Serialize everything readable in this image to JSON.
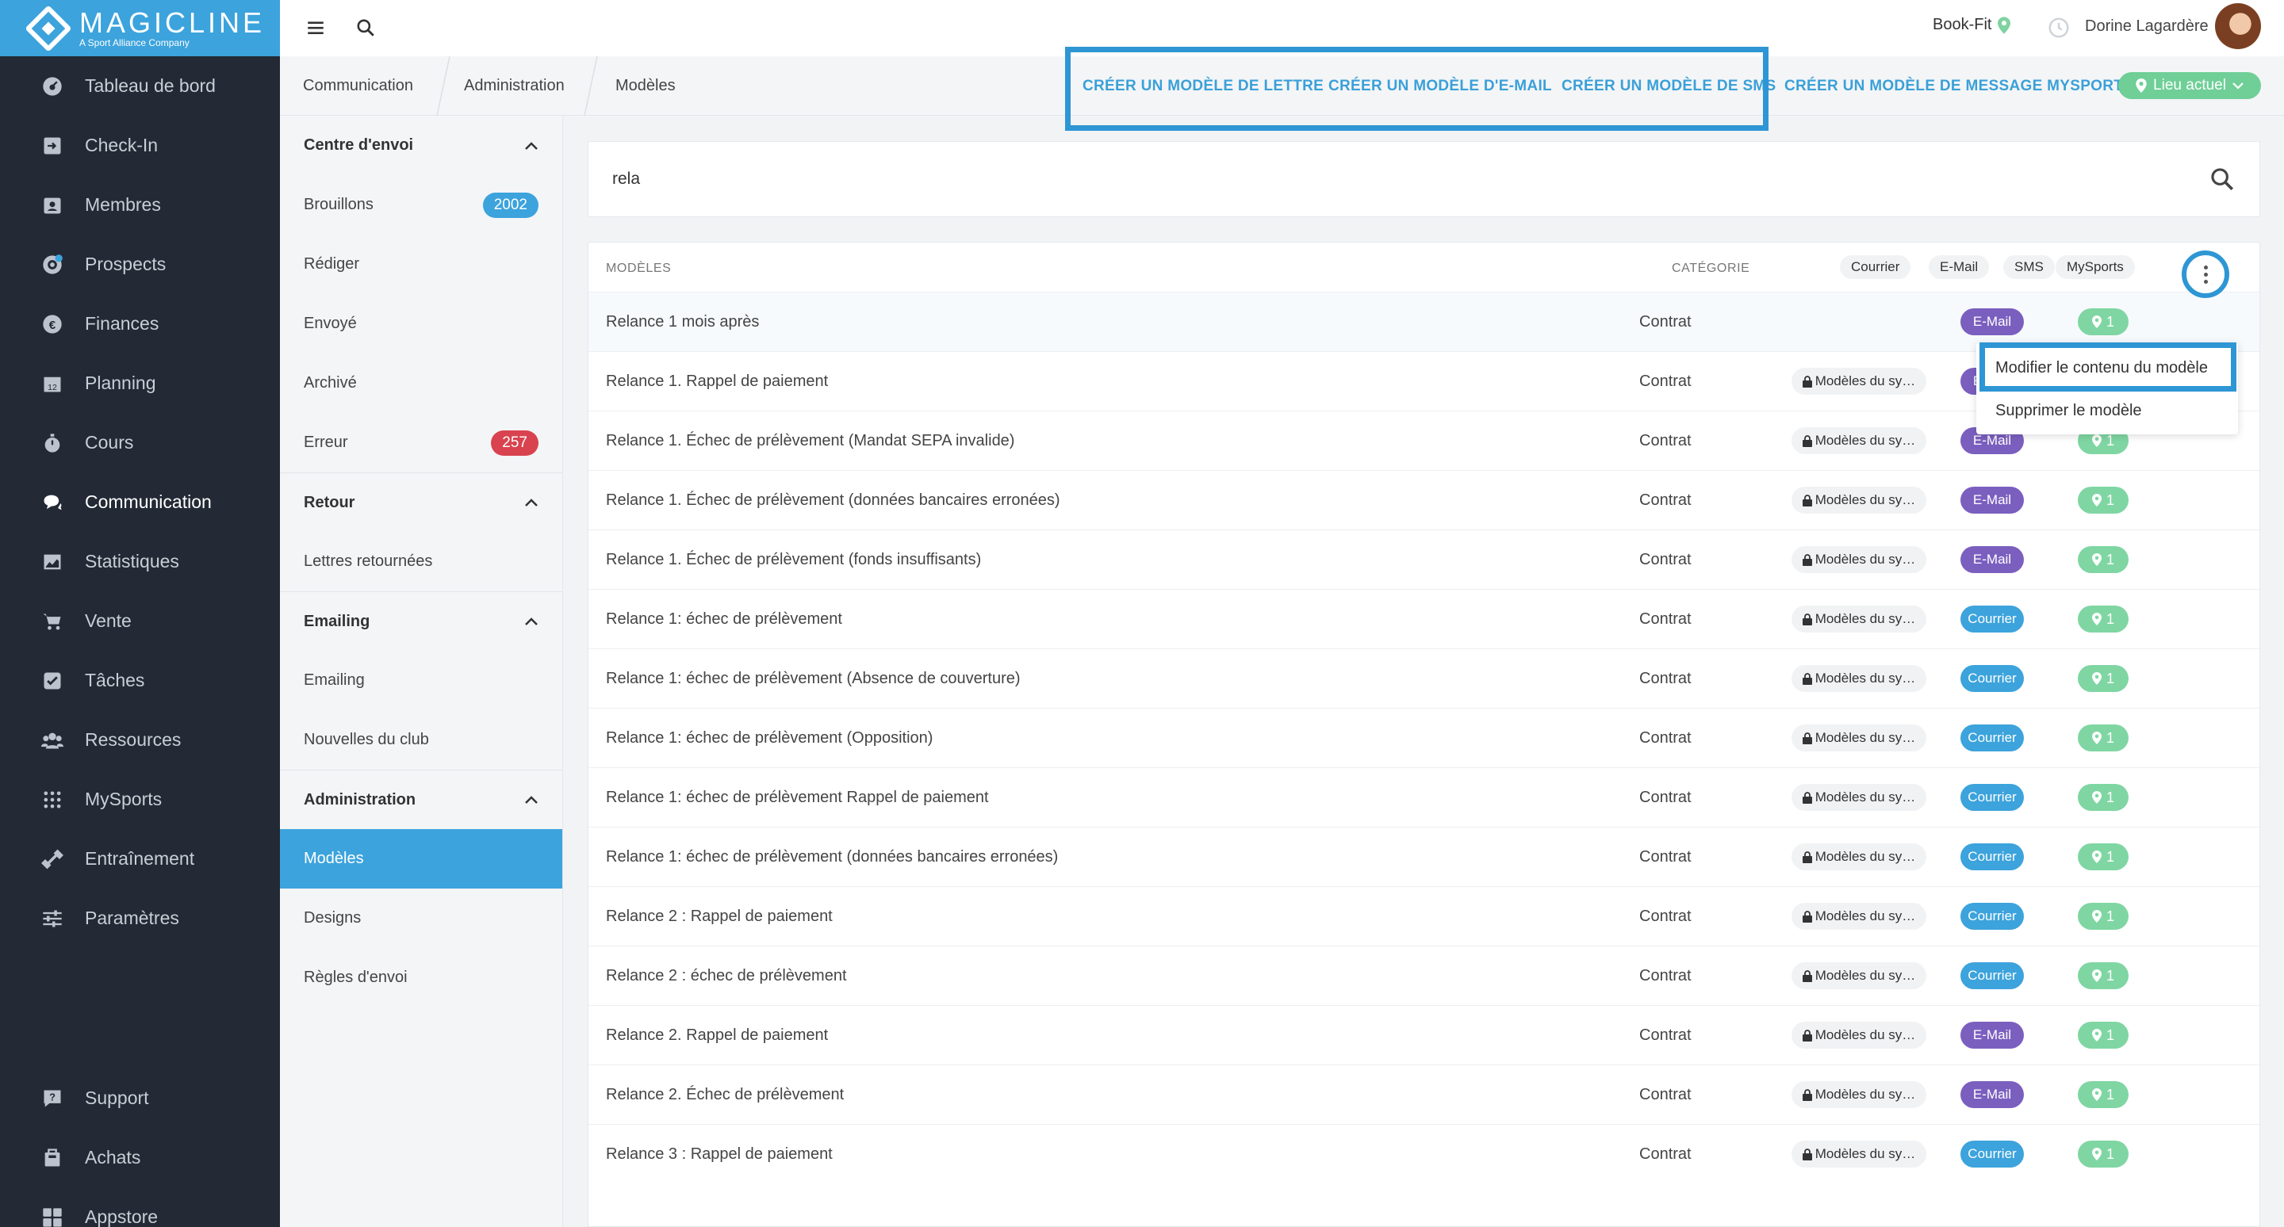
{
  "brand": {
    "name": "MAGICLINE",
    "tagline": "A Sport Alliance Company"
  },
  "sidebar": {
    "items": [
      {
        "label": "Tableau de bord",
        "icon": "dashboard-icon"
      },
      {
        "label": "Check-In",
        "icon": "check-in-icon"
      },
      {
        "label": "Membres",
        "icon": "members-icon"
      },
      {
        "label": "Prospects",
        "icon": "prospects-icon"
      },
      {
        "label": "Finances",
        "icon": "finances-icon"
      },
      {
        "label": "Planning",
        "icon": "calendar-icon"
      },
      {
        "label": "Cours",
        "icon": "stopwatch-icon"
      },
      {
        "label": "Communication",
        "icon": "chat-icon",
        "active": true
      },
      {
        "label": "Statistiques",
        "icon": "chart-icon"
      },
      {
        "label": "Vente",
        "icon": "cart-icon"
      },
      {
        "label": "Tâches",
        "icon": "checkbox-icon"
      },
      {
        "label": "Ressources",
        "icon": "people-icon"
      },
      {
        "label": "MySports",
        "icon": "mysports-icon"
      },
      {
        "label": "Entraînement",
        "icon": "dumbbell-icon"
      },
      {
        "label": "Paramètres",
        "icon": "sliders-icon"
      }
    ],
    "bottom": [
      {
        "label": "Support",
        "icon": "support-icon"
      },
      {
        "label": "Achats",
        "icon": "purchases-icon"
      },
      {
        "label": "Appstore",
        "icon": "apps-icon"
      }
    ]
  },
  "topbar": {
    "studio": "Book-Fit",
    "user": "Dorine Lagardère"
  },
  "breadcrumb": [
    "Communication",
    "Administration",
    "Modèles"
  ],
  "actions": {
    "letter": "CRÉER UN MODÈLE DE LETTRE",
    "email": "CRÉER UN MODÈLE D'E-MAIL",
    "sms": "CRÉER UN MODÈLE DE SMS",
    "mysports": "CRÉER UN MODÈLE DE MESSAGE MYSPORTS",
    "location": "Lieu actuel"
  },
  "subnav": {
    "sections": [
      {
        "title": "Centre d'envoi",
        "items": [
          {
            "label": "Brouillons",
            "badge": "2002",
            "badge_color": "blue"
          },
          {
            "label": "Rédiger"
          },
          {
            "label": "Envoyé"
          },
          {
            "label": "Archivé"
          },
          {
            "label": "Erreur",
            "badge": "257",
            "badge_color": "red"
          }
        ]
      },
      {
        "title": "Retour",
        "items": [
          {
            "label": "Lettres retournées"
          }
        ]
      },
      {
        "title": "Emailing",
        "items": [
          {
            "label": "Emailing"
          },
          {
            "label": "Nouvelles du club"
          }
        ]
      },
      {
        "title": "Administration",
        "items": [
          {
            "label": "Modèles",
            "active": true
          },
          {
            "label": "Designs"
          },
          {
            "label": "Règles d'envoi"
          }
        ]
      }
    ]
  },
  "search": {
    "value": "rela"
  },
  "table": {
    "headers": {
      "name": "MODÈLES",
      "category": "CATÉGORIE"
    },
    "filters": [
      "Courrier",
      "E-Mail",
      "SMS",
      "MySports"
    ],
    "rows": [
      {
        "name": "Relance 1 mois après",
        "category": "Contrat",
        "system": "",
        "type": "E-Mail",
        "count": "1"
      },
      {
        "name": "Relance 1. Rappel de paiement",
        "category": "Contrat",
        "system": "Modèles du sy…",
        "type": "E-Mail",
        "count": "1"
      },
      {
        "name": "Relance 1. Échec de prélèvement (Mandat SEPA invalide)",
        "category": "Contrat",
        "system": "Modèles du sy…",
        "type": "E-Mail",
        "count": "1"
      },
      {
        "name": "Relance 1. Échec de prélèvement (données bancaires erronées)",
        "category": "Contrat",
        "system": "Modèles du sy…",
        "type": "E-Mail",
        "count": "1"
      },
      {
        "name": "Relance 1. Échec de prélèvement (fonds insuffisants)",
        "category": "Contrat",
        "system": "Modèles du sy…",
        "type": "E-Mail",
        "count": "1"
      },
      {
        "name": "Relance 1: échec de prélèvement",
        "category": "Contrat",
        "system": "Modèles du sy…",
        "type": "Courrier",
        "count": "1"
      },
      {
        "name": "Relance 1: échec de prélèvement (Absence de couverture)",
        "category": "Contrat",
        "system": "Modèles du sy…",
        "type": "Courrier",
        "count": "1"
      },
      {
        "name": "Relance 1: échec de prélèvement (Opposition)",
        "category": "Contrat",
        "system": "Modèles du sy…",
        "type": "Courrier",
        "count": "1"
      },
      {
        "name": "Relance 1: échec de prélèvement Rappel de paiement",
        "category": "Contrat",
        "system": "Modèles du sy…",
        "type": "Courrier",
        "count": "1"
      },
      {
        "name": "Relance 1: échec de prélèvement (données bancaires erronées)",
        "category": "Contrat",
        "system": "Modèles du sy…",
        "type": "Courrier",
        "count": "1"
      },
      {
        "name": "Relance 2 : Rappel de paiement",
        "category": "Contrat",
        "system": "Modèles du sy…",
        "type": "Courrier",
        "count": "1"
      },
      {
        "name": "Relance 2 : échec de prélèvement",
        "category": "Contrat",
        "system": "Modèles du sy…",
        "type": "Courrier",
        "count": "1"
      },
      {
        "name": "Relance 2. Rappel de paiement",
        "category": "Contrat",
        "system": "Modèles du sy…",
        "type": "E-Mail",
        "count": "1"
      },
      {
        "name": "Relance 2. Échec de prélèvement",
        "category": "Contrat",
        "system": "Modèles du sy…",
        "type": "E-Mail",
        "count": "1"
      },
      {
        "name": "Relance 3 : Rappel de paiement",
        "category": "Contrat",
        "system": "Modèles du sy…",
        "type": "Courrier",
        "count": "1"
      }
    ]
  },
  "context_menu": {
    "edit": "Modifier le contenu du modèle",
    "delete": "Supprimer le modèle"
  },
  "colors": {
    "accent": "#3ca3dc",
    "sidebar": "#232a35",
    "email": "#7b5fbf",
    "location": "#7fd6a2",
    "badge_red": "#d9434f",
    "highlight": "#2e96d4"
  }
}
